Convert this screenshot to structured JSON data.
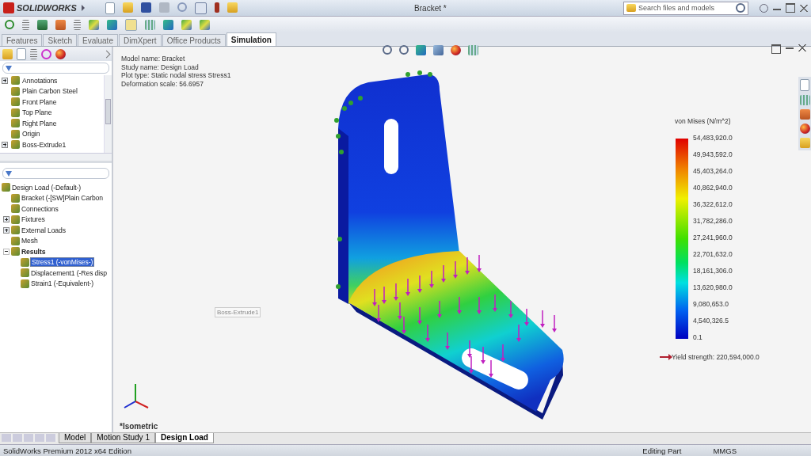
{
  "app": {
    "logo": "SOLIDWORKS",
    "title": "Bracket *",
    "search": {
      "placeholder": "Search files and models"
    }
  },
  "command_tabs": [
    {
      "label": "Features",
      "selected": false
    },
    {
      "label": "Sketch",
      "selected": false
    },
    {
      "label": "Evaluate",
      "selected": false
    },
    {
      "label": "DimXpert",
      "selected": false
    },
    {
      "label": "Office Products",
      "selected": false
    },
    {
      "label": "Simulation",
      "selected": true
    }
  ],
  "feature_tree": {
    "items": [
      {
        "name": "Annotations",
        "expanded": false,
        "selected": false
      },
      {
        "name": "Plain Carbon Steel",
        "selected": false
      },
      {
        "name": "Front Plane",
        "selected": false
      },
      {
        "name": "Top Plane",
        "selected": false
      },
      {
        "name": "Right Plane",
        "selected": false
      },
      {
        "name": "Origin",
        "selected": false
      },
      {
        "name": "Boss-Extrude1",
        "expanded": false,
        "selected": false
      }
    ]
  },
  "study_tree": {
    "items": [
      {
        "name": "Design Load (-Default-)",
        "selected": false,
        "children": [
          {
            "name": "Bracket (-[SW]Plain Carbon",
            "selected": false
          },
          {
            "name": "Connections",
            "selected": false
          },
          {
            "name": "Fixtures",
            "expanded": false,
            "selected": false
          },
          {
            "name": "External Loads",
            "expanded": false,
            "selected": false
          },
          {
            "name": "Mesh",
            "selected": false
          },
          {
            "name": "Results",
            "expanded": true,
            "bold": true,
            "selected": false,
            "children": [
              {
                "name": "Stress1 (-vonMises-)",
                "selected": true
              },
              {
                "name": "Displacement1 (-Res disp",
                "selected": false
              },
              {
                "name": "Strain1 (-Equivalent-)",
                "selected": false
              }
            ]
          }
        ]
      }
    ]
  },
  "plot_info": [
    "Model name: Bracket",
    "Study name: Design Load",
    "Plot type: Static nodal stress Stress1",
    "Deformation scale: 56.6957"
  ],
  "tooltip": "Boss-Extrude1",
  "view_name": "*Isometric",
  "legend": {
    "title": "von Mises (N/m^2)",
    "labels": [
      "54,483,920.0",
      "49,943,592.0",
      "45,403,264.0",
      "40,862,940.0",
      "36,322,612.0",
      "31,782,286.0",
      "27,241,960.0",
      "22,701,632.0",
      "18,161,306.0",
      "13,620,980.0",
      "9,080,653.0",
      "4,540,326.5",
      "0.1"
    ],
    "yield_strength": "Yield strength: 220,594,000.0"
  },
  "bottom_tabs": [
    {
      "label": "Model",
      "selected": false
    },
    {
      "label": "Motion Study 1",
      "selected": false
    },
    {
      "label": "Design Load",
      "selected": true
    }
  ],
  "status_bar": {
    "edition": "SolidWorks Premium 2012 x64 Edition",
    "mode": "Editing Part",
    "units": "MMGS"
  }
}
